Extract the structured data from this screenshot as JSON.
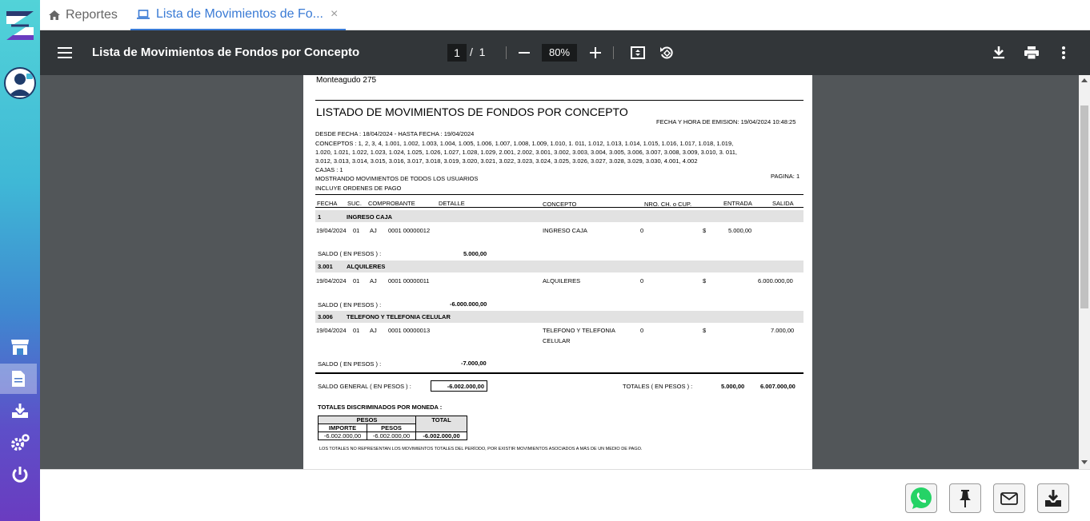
{
  "tabs": [
    {
      "label": "Reportes",
      "icon": "home-icon"
    },
    {
      "label": "Lista de Movimientos de Fo...",
      "icon": "laptop-icon",
      "close": "×"
    }
  ],
  "pdf_toolbar": {
    "title": "Lista de Movimientos de Fondos por Concepto",
    "current_page": "1",
    "page_sep": "/",
    "total_pages": "1",
    "zoom": "80%"
  },
  "report": {
    "address": "Monteagudo 275",
    "title": "LISTADO DE MOVIMIENTOS DE FONDOS POR CONCEPTO",
    "emision": "FECHA Y HORA DE EMISION: 19/04/2024 10:48:25",
    "desde": "DESDE FECHA : 18/04/2024 - HASTA FECHA : 19/04/2024",
    "conceptos_1": "CONCEPTOS : 1, 2, 3, 4, 1.001, 1.002, 1.003, 1.004, 1.005, 1.006, 1.007, 1.008, 1.009, 1.010, 1. 011, 1.012, 1.013, 1.014, 1.015, 1.016, 1.017, 1.018, 1.019,",
    "conceptos_2": "1.020, 1.021, 1.022, 1.023, 1.024, 1.025, 1.026, 1.027, 1.028, 1.029, 2.001, 2.002, 3.001, 3.002, 3.003, 3.004, 3.005, 3.006, 3.007, 3.008, 3.009, 3.010, 3. 011,",
    "conceptos_3": "3.012, 3.013, 3.014, 3.015, 3.016, 3.017, 3.018, 3.019, 3.020, 3.021, 3.022, 3.023, 3.024, 3.025, 3.026, 3.027, 3.028, 3.029, 3.030, 4.001, 4.002",
    "cajas": "CAJAS : 1",
    "mostrando": "MOSTRANDO MOVIMIENTOS DE TODOS LOS USUARIOS",
    "pagina": "PAGINA: 1",
    "incluye": "INCLUYE ORDENES DE PAGO",
    "columns": {
      "fecha": "FECHA",
      "suc": "SUC.",
      "comprobante": "COMPROBANTE",
      "detalle": "DETALLE",
      "concepto": "CONCEPTO",
      "nro": "NRO. CH. o CUP.",
      "entrada": "ENTRADA",
      "salida": "SALIDA"
    },
    "groups": [
      {
        "code": "1",
        "name": "INGRESO CAJA",
        "fecha": "19/04/2024",
        "suc": "01",
        "tipo": "AJ",
        "comprobante": "0001  00000012",
        "concepto": "INGRESO CAJA",
        "concepto_2": "",
        "nro": "0",
        "moneda": "$",
        "entrada": "5.000,00",
        "salida": "",
        "saldo_label": "SALDO  ( EN PESOS ) :",
        "saldo": "5.000,00"
      },
      {
        "code": "3.001",
        "name": "ALQUILERES",
        "fecha": "19/04/2024",
        "suc": "01",
        "tipo": "AJ",
        "comprobante": "0001  00000011",
        "concepto": "ALQUILERES",
        "concepto_2": "",
        "nro": "0",
        "moneda": "$",
        "entrada": "",
        "salida": "6.000.000,00",
        "saldo_label": "SALDO  ( EN PESOS ) :",
        "saldo": "-6.000.000,00"
      },
      {
        "code": "3.006",
        "name": "TELEFONO Y TELEFONIA CELULAR",
        "fecha": "19/04/2024",
        "suc": "01",
        "tipo": "AJ",
        "comprobante": "0001  00000013",
        "concepto": "TELEFONO Y TELEFONIA",
        "concepto_2": "CELULAR",
        "nro": "0",
        "moneda": "$",
        "entrada": "",
        "salida": "7.000,00",
        "saldo_label": "SALDO  ( EN PESOS ) :",
        "saldo": "-7.000,00"
      }
    ],
    "saldo_general_label": "SALDO GENERAL  ( EN PESOS ) :",
    "saldo_general": "-6.002.000,00",
    "totales_label": "TOTALES  ( EN PESOS ) :",
    "totales_entrada": "5.000,00",
    "totales_salida": "6.007.000,00",
    "discriminados_title": "TOTALES DISCRIMINADOS POR MONEDA :",
    "disc_table": {
      "h_pesos": "PESOS",
      "h_total": "TOTAL",
      "h_importe": "IMPORTE",
      "h_pesos2": "PESOS",
      "importe": "-6.002.000,00",
      "pesos": "-6.002.000,00",
      "total": "-6.002.000,00"
    },
    "nota": "LOS TOTALES NO REPRESENTAN LOS MOVIMIENTOS TOTALES DEL PERÍODO, POR EXISTIR MOVIMIENTOS ASOCIADOS A MÁS DE UN MEDIO DE PAGO."
  },
  "colors": {
    "accent": "#3a7bd5",
    "pdf_toolbar": "#323639",
    "viewer_bg": "#525659",
    "whatsapp": "#25d366"
  },
  "footer_buttons": [
    "whatsapp-icon",
    "pin-icon",
    "mail-icon",
    "download-icon"
  ],
  "sidebar_icons": [
    "store-icon",
    "document-icon",
    "download-tray-icon",
    "gears-icon",
    "power-icon"
  ]
}
